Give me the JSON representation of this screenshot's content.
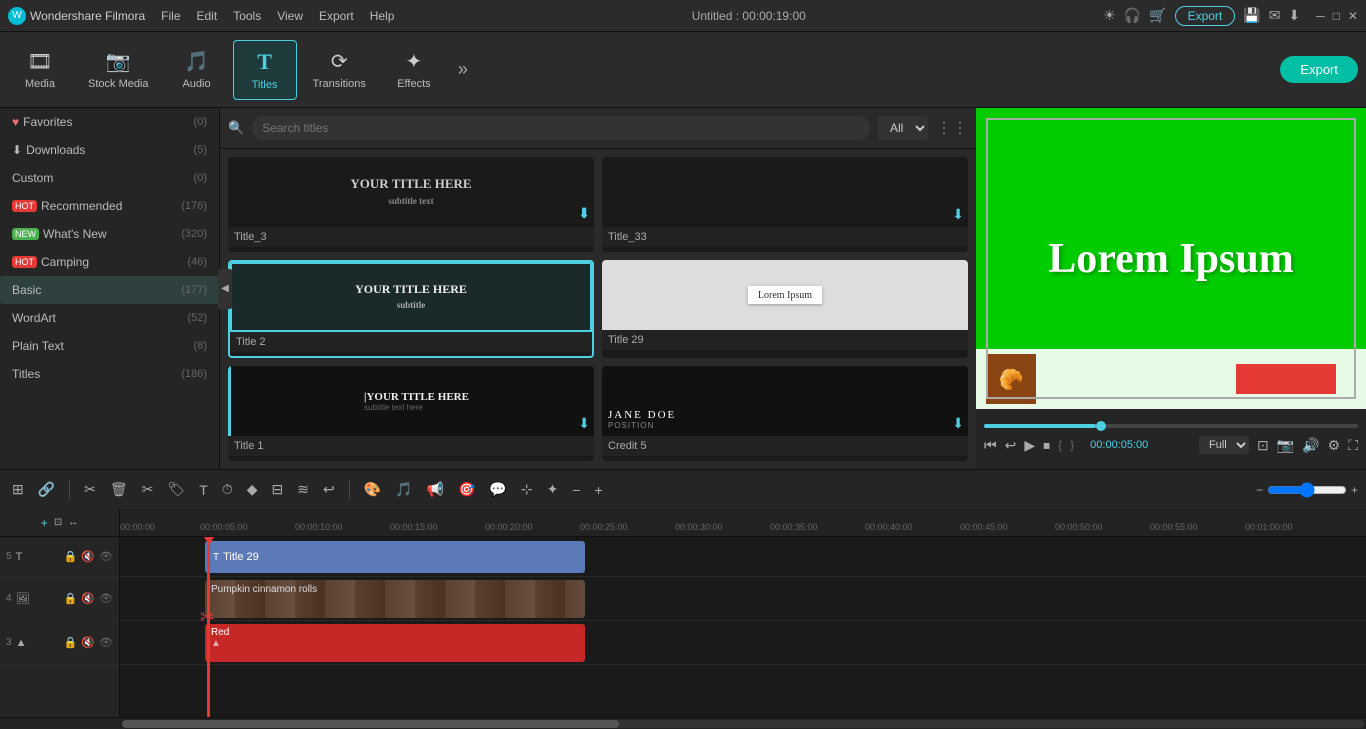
{
  "app": {
    "name": "Wondershare Filmora",
    "logo_char": "W",
    "title": "Untitled : 00:00:19:00"
  },
  "menu": {
    "items": [
      "File",
      "Edit",
      "Tools",
      "View",
      "Export",
      "Help"
    ]
  },
  "toolbar": {
    "items": [
      {
        "id": "media",
        "icon": "🎞",
        "label": "Media"
      },
      {
        "id": "stock_media",
        "icon": "📷",
        "label": "Stock Media"
      },
      {
        "id": "audio",
        "icon": "🎵",
        "label": "Audio"
      },
      {
        "id": "titles",
        "icon": "T",
        "label": "Titles"
      },
      {
        "id": "transitions",
        "icon": "⟳",
        "label": "Transitions"
      },
      {
        "id": "effects",
        "icon": "✦",
        "label": "Effects"
      }
    ],
    "active": "titles",
    "more_icon": "»",
    "export_label": "Export"
  },
  "left_panel": {
    "items": [
      {
        "id": "favorites",
        "label": "Favorites",
        "badge": null,
        "count": "(0)"
      },
      {
        "id": "downloads",
        "label": "Downloads",
        "badge": null,
        "count": "(5)"
      },
      {
        "id": "custom",
        "label": "Custom",
        "badge": null,
        "count": "(0)"
      },
      {
        "id": "recommended",
        "label": "Recommended",
        "badge": "HOT",
        "count": "(176)"
      },
      {
        "id": "whats_new",
        "label": "What's New",
        "badge": "NEW",
        "count": "(320)"
      },
      {
        "id": "camping",
        "label": "Camping",
        "badge": "HOT",
        "count": "(46)"
      },
      {
        "id": "basic",
        "label": "Basic",
        "badge": null,
        "count": "(177)"
      },
      {
        "id": "wordart",
        "label": "WordArt",
        "badge": null,
        "count": "(52)"
      },
      {
        "id": "plain_text",
        "label": "Plain Text",
        "badge": null,
        "count": "(8)"
      },
      {
        "id": "titles_cat",
        "label": "Titles",
        "badge": null,
        "count": "(186)"
      }
    ],
    "active": "basic"
  },
  "search": {
    "placeholder": "Search titles",
    "filter_options": [
      "All"
    ],
    "filter_value": "All"
  },
  "titles_grid": [
    {
      "id": "title3",
      "name": "Title_3",
      "type": "plain",
      "has_download": true
    },
    {
      "id": "title33",
      "name": "Title_33",
      "type": "plain",
      "has_download": true
    },
    {
      "id": "title2",
      "name": "Title 2",
      "type": "bordered",
      "has_download": false
    },
    {
      "id": "title29",
      "name": "Title 29",
      "type": "selected",
      "has_download": false
    },
    {
      "id": "title1",
      "name": "Title 1",
      "type": "sidebar",
      "has_download": true
    },
    {
      "id": "credit5",
      "name": "Credit 5",
      "type": "dark",
      "has_download": true
    }
  ],
  "preview": {
    "title_text": "Lorem Ipsum",
    "time_current": "00:00:05:00",
    "scrubber_pct": 30,
    "quality": "Full",
    "controls": {
      "prev_frame": "⏮",
      "back5": "↩",
      "play": "▶",
      "stop": "⏹",
      "bracket_open": "{",
      "bracket_close": "}"
    }
  },
  "timeline": {
    "tracks": [
      {
        "id": "track1",
        "num": "5",
        "type": "title",
        "clip_name": "Title 29",
        "clip_color": "#5c7ab8"
      },
      {
        "id": "track2",
        "num": "4",
        "type": "video",
        "clip_name": "Pumpkin cinnamon rolls",
        "clip_color": "#5a4030"
      },
      {
        "id": "track3",
        "num": "3",
        "type": "audio",
        "clip_name": "Red",
        "clip_color": "#c62828"
      }
    ],
    "time_markers": [
      "00:00:00",
      "00:00:05:00",
      "00:00:10:00",
      "00:00:15:00",
      "00:00:20:00",
      "00:00:25:00",
      "00:00:30:00",
      "00:00:35:00",
      "00:00:40:00",
      "00:00:45:00",
      "00:00:50:00",
      "00:00:55:00",
      "00:01:00:00"
    ],
    "playhead_time": "00:00:05:00"
  },
  "bottom_toolbar": {
    "tools": [
      {
        "id": "snap",
        "icon": "⊞",
        "label": "snap"
      },
      {
        "id": "link",
        "icon": "🔗",
        "label": "link"
      },
      {
        "id": "split",
        "icon": "✂",
        "label": "split"
      },
      {
        "id": "delete",
        "icon": "🗑",
        "label": "delete"
      },
      {
        "id": "cut",
        "icon": "✂",
        "label": "cut"
      },
      {
        "id": "tag",
        "icon": "🏷",
        "label": "tag"
      },
      {
        "id": "text",
        "icon": "T",
        "label": "text"
      },
      {
        "id": "clock",
        "icon": "⏱",
        "label": "clock"
      },
      {
        "id": "color",
        "icon": "◆",
        "label": "color"
      },
      {
        "id": "slider",
        "icon": "⊟",
        "label": "adjust"
      },
      {
        "id": "audio_icon",
        "icon": "🎵",
        "label": "audio"
      },
      {
        "id": "motion",
        "icon": "≋",
        "label": "motion"
      },
      {
        "id": "undo2",
        "icon": "↩",
        "label": "undo"
      }
    ],
    "zoom_minus": "−",
    "zoom_plus": "+",
    "zoom_value": 50
  },
  "colors": {
    "accent": "#4dd0e1",
    "hot_badge": "#e53935",
    "new_badge": "#43a047",
    "active_bg": "#2f4040",
    "export_btn": "#00bfa5"
  }
}
